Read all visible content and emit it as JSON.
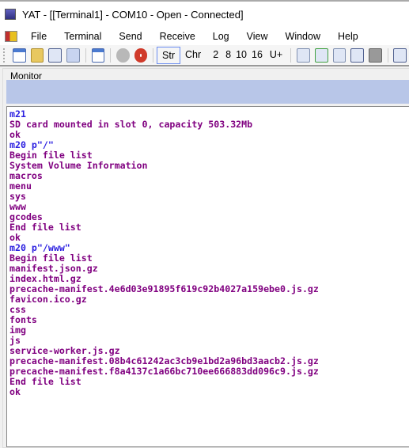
{
  "window": {
    "title": "YAT - [[Terminal1] - COM10 - Open - Connected]"
  },
  "menu": [
    "File",
    "Terminal",
    "Send",
    "Receive",
    "Log",
    "View",
    "Window",
    "Help"
  ],
  "toolbar": {
    "radix": [
      "Str",
      "Chr",
      "2",
      "8",
      "10",
      "16",
      "U+"
    ],
    "selected": "Str"
  },
  "monitor": {
    "label": "Monitor",
    "lines": [
      {
        "dir": "tx",
        "text": "m21"
      },
      {
        "dir": "rx",
        "text": "SD card mounted in slot 0, capacity 503.32Mb"
      },
      {
        "dir": "rx",
        "text": "ok"
      },
      {
        "dir": "tx",
        "text": "m20 p\"/\""
      },
      {
        "dir": "rx",
        "text": "Begin file list"
      },
      {
        "dir": "rx",
        "text": "System Volume Information"
      },
      {
        "dir": "rx",
        "text": "macros"
      },
      {
        "dir": "rx",
        "text": "menu"
      },
      {
        "dir": "rx",
        "text": "sys"
      },
      {
        "dir": "rx",
        "text": "www"
      },
      {
        "dir": "rx",
        "text": "gcodes"
      },
      {
        "dir": "rx",
        "text": "End file list"
      },
      {
        "dir": "rx",
        "text": "ok"
      },
      {
        "dir": "tx",
        "text": "m20 p\"/www\""
      },
      {
        "dir": "rx",
        "text": "Begin file list"
      },
      {
        "dir": "rx",
        "text": "manifest.json.gz"
      },
      {
        "dir": "rx",
        "text": "index.html.gz"
      },
      {
        "dir": "rx",
        "text": "precache-manifest.4e6d03e91895f619c92b4027a159ebe0.js.gz"
      },
      {
        "dir": "rx",
        "text": "favicon.ico.gz"
      },
      {
        "dir": "rx",
        "text": "css"
      },
      {
        "dir": "rx",
        "text": "fonts"
      },
      {
        "dir": "rx",
        "text": "img"
      },
      {
        "dir": "rx",
        "text": "js"
      },
      {
        "dir": "rx",
        "text": "service-worker.js.gz"
      },
      {
        "dir": "rx",
        "text": "precache-manifest.08b4c61242ac3cb9e1bd2a96bd3aacb2.js.gz"
      },
      {
        "dir": "rx",
        "text": "precache-manifest.f8a4137c1a66bc710ee666883dd096c9.js.gz"
      },
      {
        "dir": "rx",
        "text": "End file list"
      },
      {
        "dir": "rx",
        "text": "ok"
      }
    ]
  },
  "colors": {
    "sent": "#2a1ee0",
    "received": "#800080",
    "band": "#b8c6e8"
  }
}
